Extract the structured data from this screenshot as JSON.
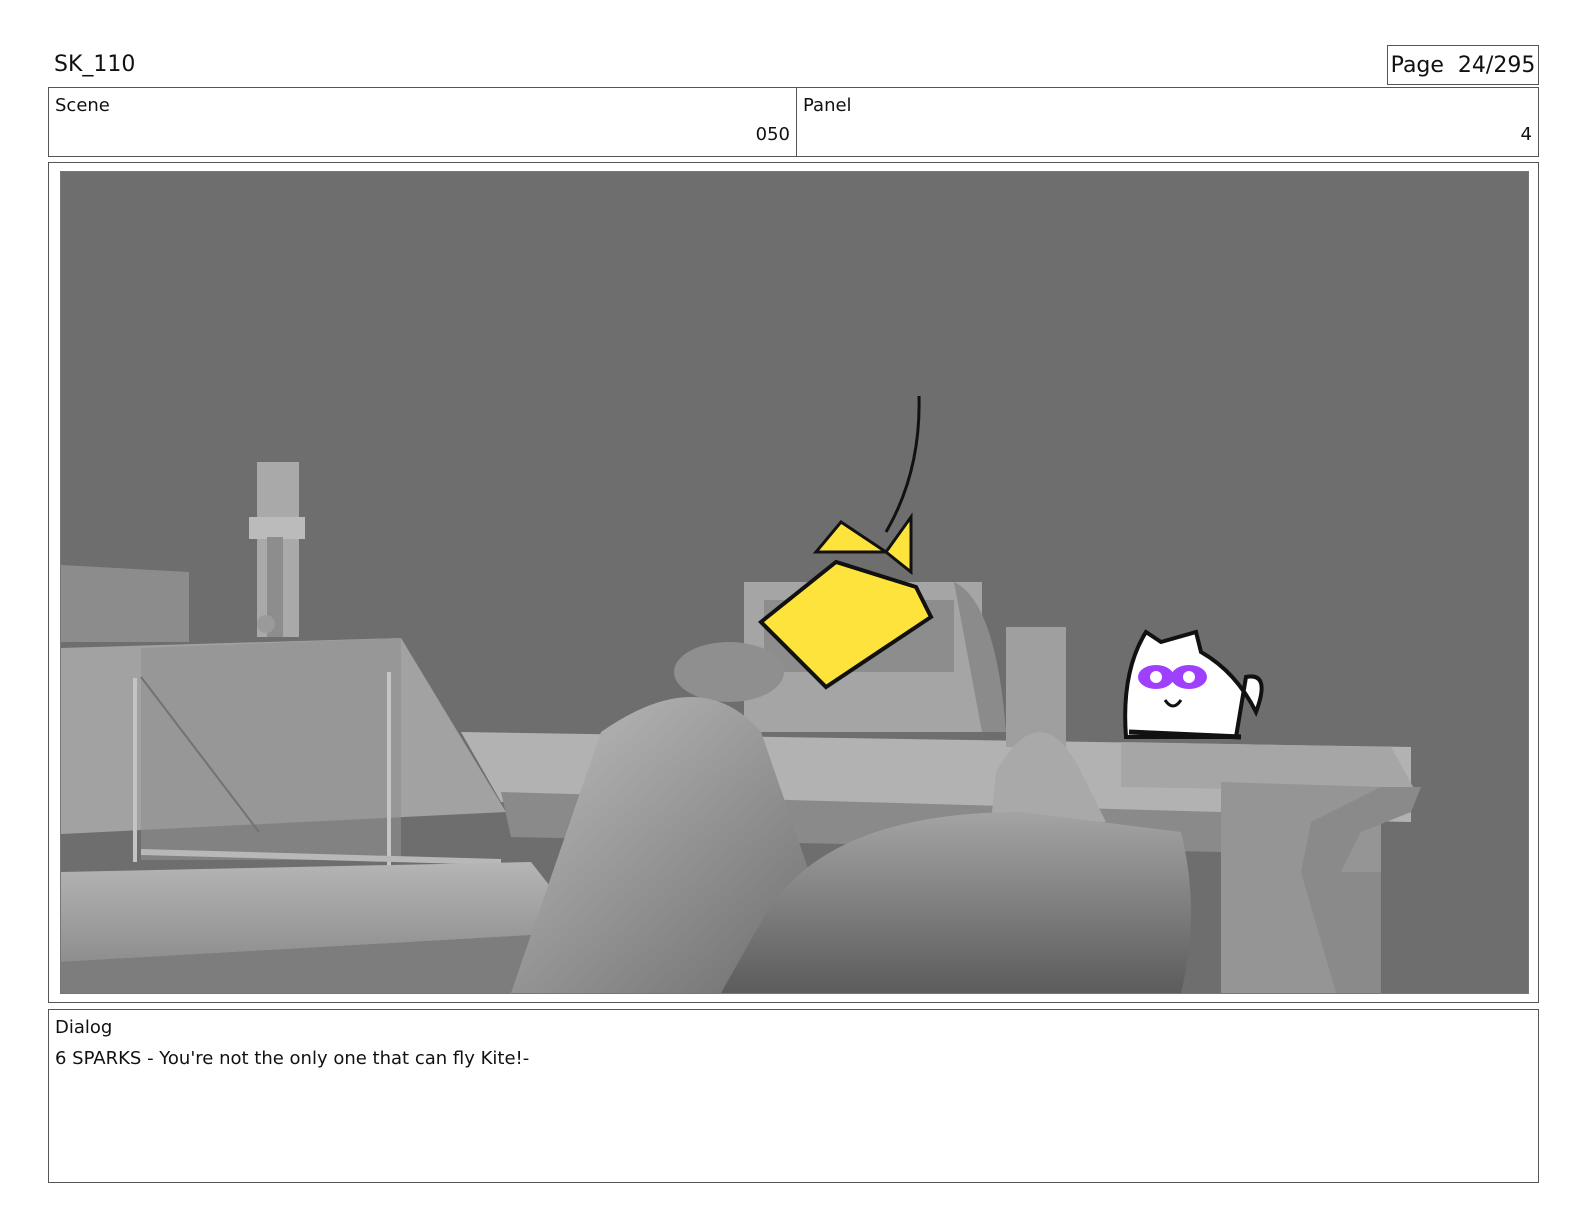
{
  "sheet": {
    "id": "SK_110",
    "page": "Page  24/295"
  },
  "meta": {
    "scene_label": "Scene",
    "scene_value": "050",
    "panel_label": "Panel",
    "panel_value": "4"
  },
  "dialog": {
    "label": "Dialog",
    "text": "6 SPARKS - You're not the only one that can fly Kite!-"
  },
  "colors": {
    "background_grey": "#6e6e6e",
    "kite_yellow": "#ffe33d",
    "mask_purple": "#a040ff"
  }
}
